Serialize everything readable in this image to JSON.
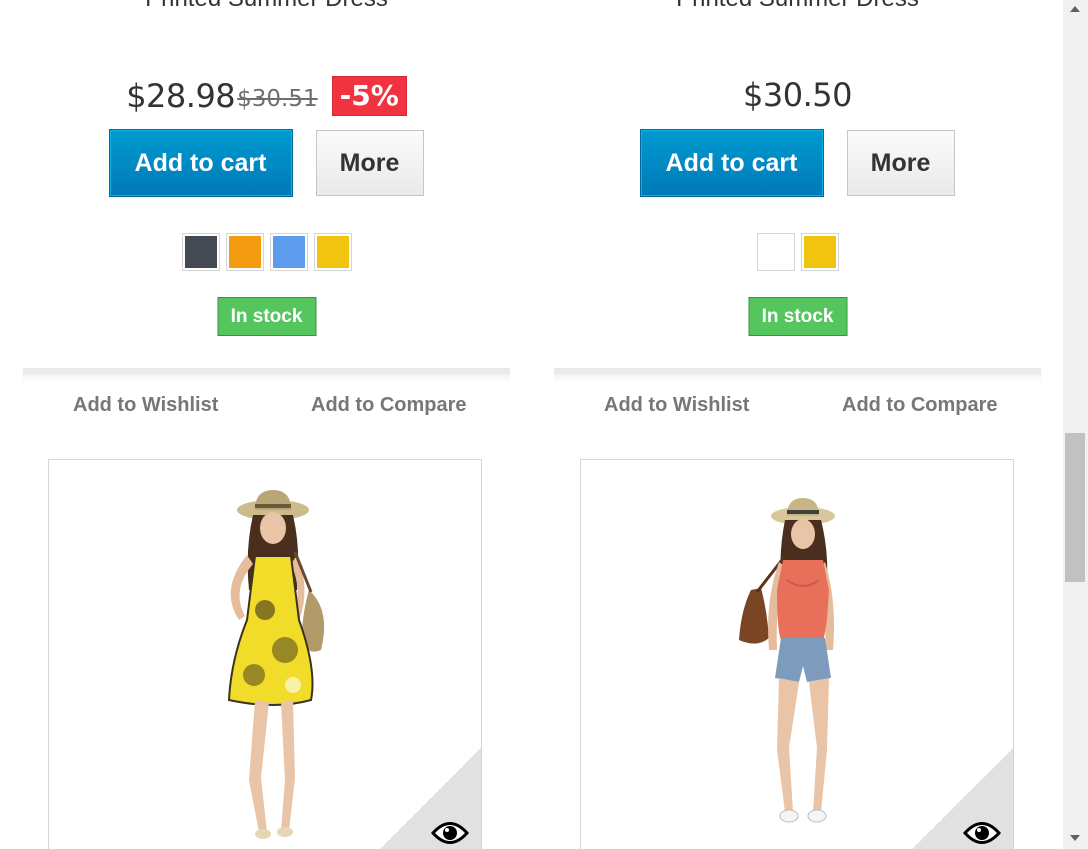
{
  "products_top": [
    {
      "name": "Printed Summer Dress",
      "price": "$28.98",
      "old_price": "$30.51",
      "discount": "-5%",
      "add_to_cart": "Add to cart",
      "more": "More",
      "colors": [
        "#434a54",
        "#f39c11",
        "#5d9cec",
        "#f1c40f"
      ],
      "stock": "In stock",
      "wishlist": "Add to Wishlist",
      "compare": "Add to Compare"
    },
    {
      "name": "Printed Summer Dress",
      "price": "$30.50",
      "add_to_cart": "Add to cart",
      "more": "More",
      "colors": [
        "#ffffff",
        "#f1c40f"
      ],
      "stock": "In stock",
      "wishlist": "Add to Wishlist",
      "compare": "Add to Compare"
    }
  ],
  "products_bottom": [
    {
      "image": "woman-yellow-dress-photo",
      "quick_view_icon": "eye-icon"
    },
    {
      "image": "woman-orange-top-shorts-photo",
      "quick_view_icon": "eye-icon"
    }
  ],
  "colors": {
    "cart_blue": "#0088c9",
    "stock_green": "#55c65e",
    "discount_red": "#f13340"
  }
}
